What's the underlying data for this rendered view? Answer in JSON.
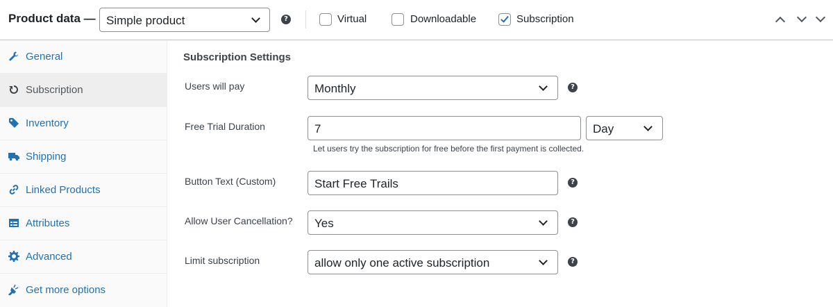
{
  "header": {
    "title": "Product data —",
    "product_type": {
      "selected": "Simple product"
    },
    "help_glyph": "?",
    "checkboxes": [
      {
        "label": "Virtual",
        "checked": false
      },
      {
        "label": "Downloadable",
        "checked": false
      },
      {
        "label": "Subscription",
        "checked": true
      }
    ],
    "arrows": [
      "arrow-up-icon",
      "arrow-down-icon"
    ]
  },
  "sidebar": {
    "active_tab": "Subscription",
    "tabs": [
      {
        "label": "General",
        "icon": "wrench-icon"
      },
      {
        "label": "Subscription",
        "icon": "refresh-icon"
      },
      {
        "label": "Inventory",
        "icon": "tag-icon"
      },
      {
        "label": "Shipping",
        "icon": "truck-icon"
      },
      {
        "label": "Linked Products",
        "icon": "link-icon"
      },
      {
        "label": "Attributes",
        "icon": "list-icon"
      },
      {
        "label": "Advanced",
        "icon": "gear-icon"
      },
      {
        "label": "Get more options",
        "icon": "plug-icon"
      }
    ]
  },
  "subscription": {
    "section_title": "Subscription Settings",
    "users_will_pay": {
      "label": "Users will pay",
      "value": "Monthly"
    },
    "free_trial": {
      "label": "Free Trial Duration",
      "value": "7",
      "unit": "Day",
      "description": "Let users try the subscription for free before the first payment is collected."
    },
    "button_text": {
      "label": "Button Text (Custom)",
      "value": "Start Free Trails"
    },
    "allow_cancellation": {
      "label": "Allow User Cancellation?",
      "value": "Yes"
    },
    "limit_subscription": {
      "label": "Limit subscription",
      "value": "allow only one active subscription"
    }
  },
  "colors": {
    "link": "#2271b1",
    "active_tab_bg": "#eeeeee",
    "sidebar_bg": "#fafafa",
    "border": "#8c8f94",
    "help_icon": "#3c434a"
  }
}
